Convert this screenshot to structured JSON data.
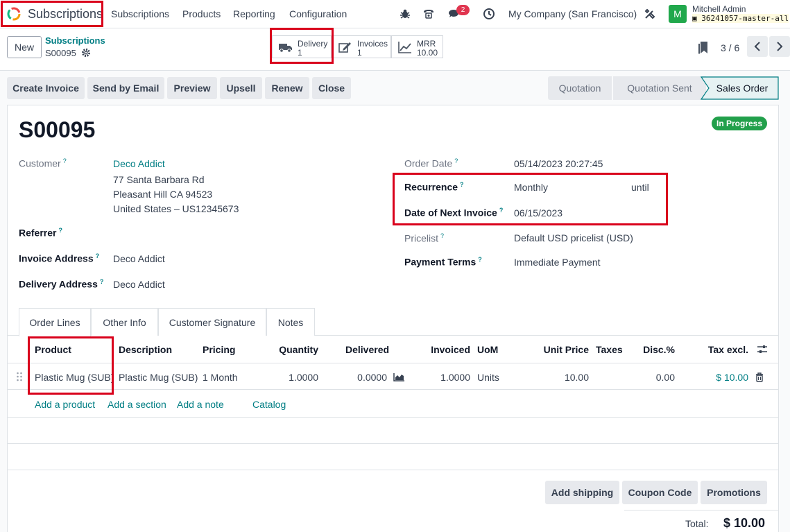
{
  "nav": {
    "app_name": "Subscriptions",
    "menu": [
      "Subscriptions",
      "Products",
      "Reporting",
      "Configuration"
    ],
    "message_count": "2",
    "company": "My Company (San Francisco)",
    "avatar_letter": "M",
    "user": "Mitchell Admin",
    "db": "36241057-master-all"
  },
  "control": {
    "new_label": "New",
    "breadcrumb_parent": "Subscriptions",
    "breadcrumb_current": "S00095",
    "smart_buttons": [
      {
        "label": "Delivery",
        "value": "1",
        "icon": "truck-icon"
      },
      {
        "label": "Invoices",
        "value": "1",
        "icon": "pencil-square-icon"
      },
      {
        "label": "MRR",
        "value": "10.00",
        "icon": "area-chart-icon"
      }
    ],
    "pager": "3 / 6"
  },
  "actions": [
    "Create Invoice",
    "Send by Email",
    "Preview",
    "Upsell",
    "Renew",
    "Close"
  ],
  "stages": [
    "Quotation",
    "Quotation Sent",
    "Sales Order"
  ],
  "record": {
    "name": "S00095",
    "status": "In Progress",
    "customer_label": "Customer",
    "customer_name": "Deco Addict",
    "address_1": "77 Santa Barbara Rd",
    "address_2": "Pleasant Hill CA 94523",
    "address_3": "United States – US12345673",
    "referrer_label": "Referrer",
    "invoice_address_label": "Invoice Address",
    "invoice_address": "Deco Addict",
    "delivery_address_label": "Delivery Address",
    "delivery_address": "Deco Addict",
    "order_date_label": "Order Date",
    "order_date": "05/14/2023 20:27:45",
    "recurrence_label": "Recurrence",
    "recurrence": "Monthly",
    "until_label": "until",
    "next_invoice_label": "Date of Next Invoice",
    "next_invoice": "06/15/2023",
    "pricelist_label": "Pricelist",
    "pricelist": "Default USD pricelist (USD)",
    "payment_terms_label": "Payment Terms",
    "payment_terms": "Immediate Payment",
    "help_mark": "?"
  },
  "tabs": [
    "Order Lines",
    "Other Info",
    "Customer Signature",
    "Notes"
  ],
  "table": {
    "headers": [
      "Product",
      "Description",
      "Pricing",
      "Quantity",
      "Delivered",
      "Invoiced",
      "UoM",
      "Unit Price",
      "Taxes",
      "Disc.%",
      "Tax excl."
    ],
    "row": {
      "product": "Plastic Mug (SUB)",
      "description": "Plastic Mug (SUB)",
      "pricing": "1 Month",
      "quantity": "1.0000",
      "delivered": "0.0000",
      "invoiced": "1.0000",
      "uom": "Units",
      "unit_price": "10.00",
      "taxes": "",
      "discount": "0.00",
      "subtotal": "$ 10.00"
    },
    "add_links": [
      "Add a product",
      "Add a section",
      "Add a note",
      "Catalog"
    ]
  },
  "footer": {
    "buttons": [
      "Add shipping",
      "Coupon Code",
      "Promotions"
    ],
    "total_label": "Total:",
    "total_value": "$ 10.00"
  }
}
